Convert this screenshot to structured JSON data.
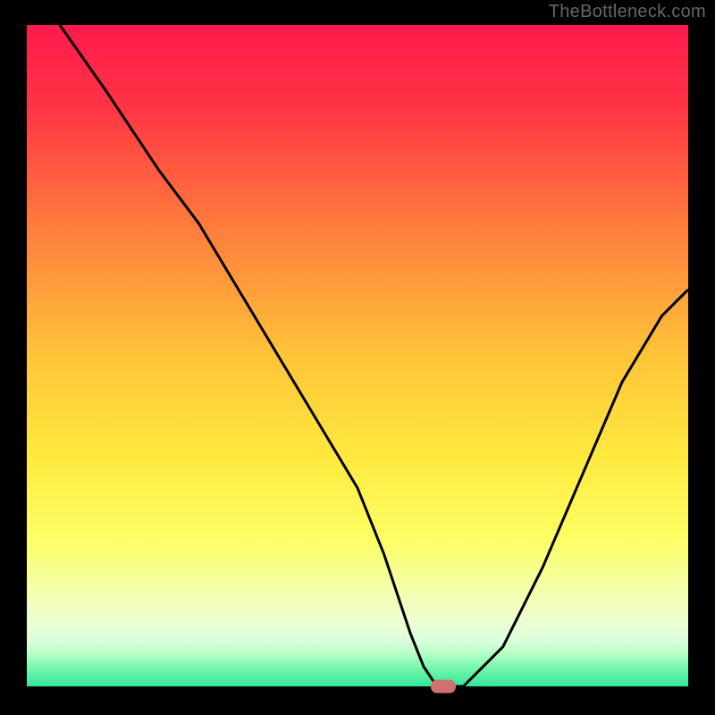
{
  "attribution": "TheBottleneck.com",
  "chart_data": {
    "type": "line",
    "title": "",
    "xlabel": "",
    "ylabel": "",
    "xlim": [
      0,
      100
    ],
    "ylim": [
      0,
      100
    ],
    "grid": false,
    "gradient_stops": [
      {
        "offset": 0,
        "color": "#ff1a4d"
      },
      {
        "offset": 12,
        "color": "#ff3345"
      },
      {
        "offset": 30,
        "color": "#ff7a3c"
      },
      {
        "offset": 50,
        "color": "#ffc43a"
      },
      {
        "offset": 65,
        "color": "#ffe93e"
      },
      {
        "offset": 78,
        "color": "#fcff66"
      },
      {
        "offset": 86,
        "color": "#f3ffb0"
      },
      {
        "offset": 90,
        "color": "#ecffd0"
      },
      {
        "offset": 93,
        "color": "#dcffdc"
      },
      {
        "offset": 95,
        "color": "#b8ffc8"
      },
      {
        "offset": 97,
        "color": "#7cf7b0"
      },
      {
        "offset": 100,
        "color": "#30e898"
      }
    ],
    "series": [
      {
        "name": "bottleneck-curve",
        "x": [
          5,
          12,
          20,
          26,
          32,
          38,
          44,
          50,
          54,
          56,
          58,
          60,
          62,
          66,
          72,
          78,
          84,
          90,
          96,
          100
        ],
        "y": [
          100,
          90,
          78,
          70,
          60,
          50,
          40,
          30,
          20,
          14,
          8,
          3,
          0,
          0,
          6,
          18,
          32,
          46,
          56,
          60
        ]
      }
    ],
    "optimum_marker": {
      "x": 63,
      "y": 0,
      "color": "#d07070"
    }
  }
}
